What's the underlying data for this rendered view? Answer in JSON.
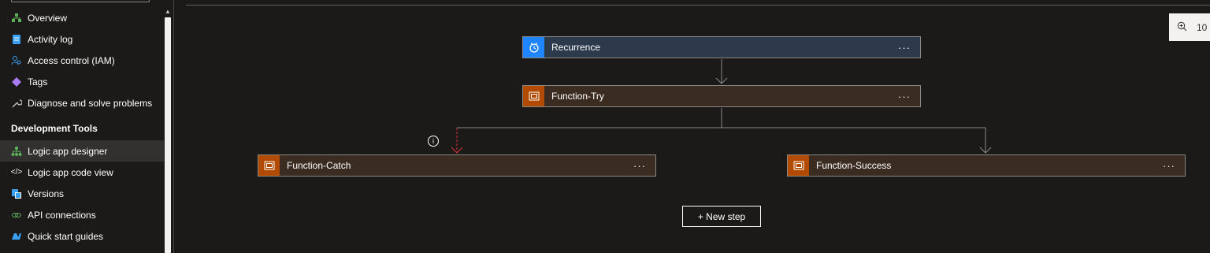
{
  "sidebar": {
    "items": [
      {
        "label": "Overview",
        "icon": "overview-icon",
        "color": "#5db05a"
      },
      {
        "label": "Activity log",
        "icon": "activity-log-icon",
        "color": "#3aa0f3"
      },
      {
        "label": "Access control (IAM)",
        "icon": "access-control-icon",
        "color": "#3aa0f3"
      },
      {
        "label": "Tags",
        "icon": "tag-icon",
        "color": "#a97bf0"
      },
      {
        "label": "Diagnose and solve problems",
        "icon": "wrench-icon",
        "color": "#c8c6c4"
      }
    ],
    "section_header": "Development Tools",
    "dev_items": [
      {
        "label": "Logic app designer",
        "icon": "logic-designer-icon",
        "color": "#5db05a"
      },
      {
        "label": "Logic app code view",
        "icon": "code-icon",
        "color": "#ffffff"
      },
      {
        "label": "Versions",
        "icon": "versions-icon",
        "color": "#3aa0f3"
      },
      {
        "label": "API connections",
        "icon": "api-connection-icon",
        "color": "#5db05a"
      },
      {
        "label": "Quick start guides",
        "icon": "quick-start-icon",
        "color": "#3aa0f3"
      }
    ]
  },
  "canvas": {
    "zoom_label": "10",
    "steps": {
      "recurrence": "Recurrence",
      "function_try": "Function-Try",
      "function_catch": "Function-Catch",
      "function_success": "Function-Success"
    },
    "more_label": "···",
    "new_step_label": "+ New step",
    "info_symbol": "i",
    "colors": {
      "recurrence_accent": "#1f85ff",
      "function_accent": "#b24a00",
      "failure_arrow": "#d13438"
    }
  }
}
